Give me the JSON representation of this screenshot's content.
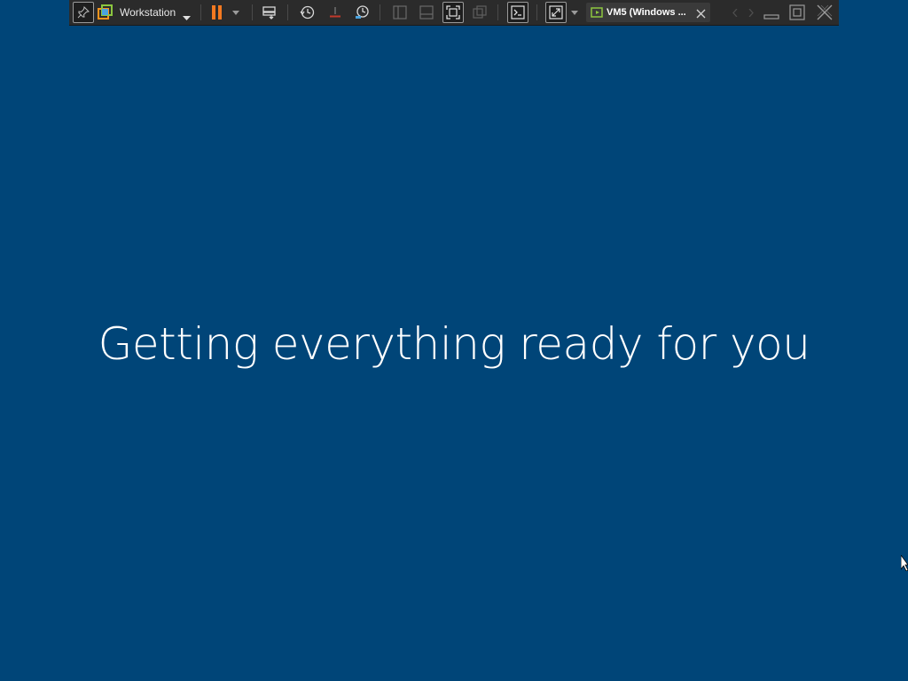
{
  "toolbar": {
    "workstation_label": "Workstation",
    "vm_tab_label": "VM5 (Windows ...",
    "colors": {
      "background": "#2b2b2b",
      "pause_accent": "#f47920",
      "workstation_logo": "#f7941d",
      "vm_icon": "#8cc63f"
    },
    "icons": [
      "pin-icon",
      "workstation-logo-icon",
      "chevron-down-icon",
      "pause-icon",
      "chevron-down-icon",
      "send-ctrl-alt-del-icon",
      "snapshot-take-icon",
      "snapshot-revert-icon",
      "snapshot-manager-icon",
      "show-library-icon",
      "show-thumbnail-bar-icon",
      "full-screen-icon",
      "unity-icon",
      "console-view-icon",
      "stretch-guest-icon",
      "chevron-down-icon",
      "vm-icon",
      "close-tab-icon",
      "previous-tab-icon",
      "next-tab-icon",
      "minimize-icon",
      "restore-icon",
      "close-window-icon"
    ]
  },
  "guest": {
    "status_text": "Getting everything ready for you",
    "background_color": "#004578",
    "text_color": "#ffffff"
  }
}
